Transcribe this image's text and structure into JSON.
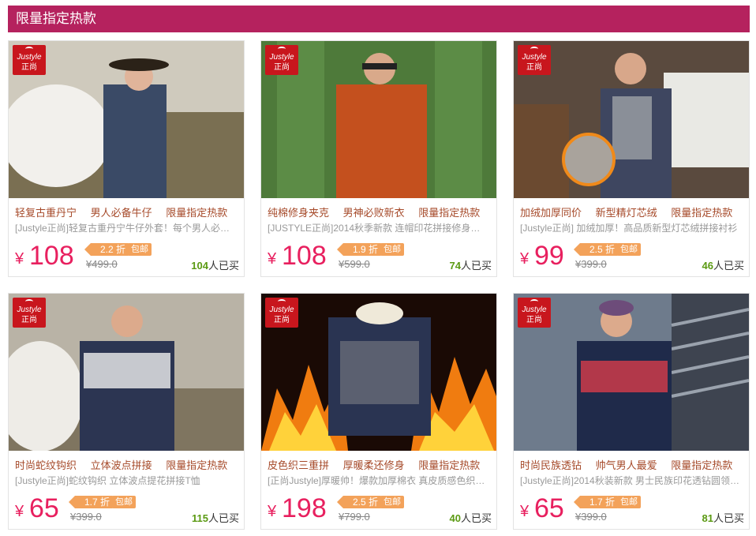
{
  "section": {
    "title": "限量指定热款"
  },
  "colors": {
    "accent": "#b5225e",
    "price": "#e8205f",
    "sold_count": "#5b9a13",
    "discount_tag": "#f3a25a"
  },
  "brand_tag": {
    "line1": "Justyle",
    "line2": "正尚"
  },
  "products": [
    {
      "tags": [
        "轻复古重丹宁",
        "男人必备牛仔",
        "限量指定热款"
      ],
      "desc": "[Justyle正尚]轻复古重丹宁牛仔外套！每个男人必…",
      "yen": "¥",
      "price": "108",
      "discount": "2.2 折",
      "baoyou": "包邮",
      "orig_price": "499.0",
      "sold_count": "104",
      "sold_suffix": "人已买"
    },
    {
      "tags": [
        "纯棉修身夹克",
        "男神必败新衣",
        "限量指定热款"
      ],
      "desc": "[JUSTYLE正尚]2014秋季新款 连帽印花拼接修身男…",
      "yen": "¥",
      "price": "108",
      "discount": "1.9 折",
      "baoyou": "包邮",
      "orig_price": "599.0",
      "sold_count": "74",
      "sold_suffix": "人已买"
    },
    {
      "tags": [
        "加绒加厚同价",
        "新型精灯芯绒",
        "限量指定热款"
      ],
      "desc": "[Justyle正尚] 加绒加厚！高品质新型灯芯绒拼接衬衫",
      "yen": "¥",
      "price": "99",
      "discount": "2.5 折",
      "baoyou": "包邮",
      "orig_price": "399.0",
      "sold_count": "46",
      "sold_suffix": "人已买"
    },
    {
      "tags": [
        "时尚蛇纹钩织",
        "立体波点拼接",
        "限量指定热款"
      ],
      "desc": "[Justyle正尚]蛇纹钩织 立体波点提花拼接T恤",
      "yen": "¥",
      "price": "65",
      "discount": "1.7 折",
      "baoyou": "包邮",
      "orig_price": "399.0",
      "sold_count": "115",
      "sold_suffix": "人已买"
    },
    {
      "tags": [
        "皮色织三重拼",
        "厚暖柔还修身",
        "限量指定热款"
      ],
      "desc": "[正尚Justyle]厚暖帅！爆款加厚棉衣 真皮质感色织…",
      "yen": "¥",
      "price": "198",
      "discount": "2.5 折",
      "baoyou": "包邮",
      "orig_price": "799.0",
      "sold_count": "40",
      "sold_suffix": "人已买"
    },
    {
      "tags": [
        "时尚民族透钻",
        "帅气男人最爱",
        "限量指定热款"
      ],
      "desc": "[Justyle正尚]2014秋装新款 男士民族印花透钻圆领…",
      "yen": "¥",
      "price": "65",
      "discount": "1.7 折",
      "baoyou": "包邮",
      "orig_price": "399.0",
      "sold_count": "81",
      "sold_suffix": "人已买"
    }
  ]
}
